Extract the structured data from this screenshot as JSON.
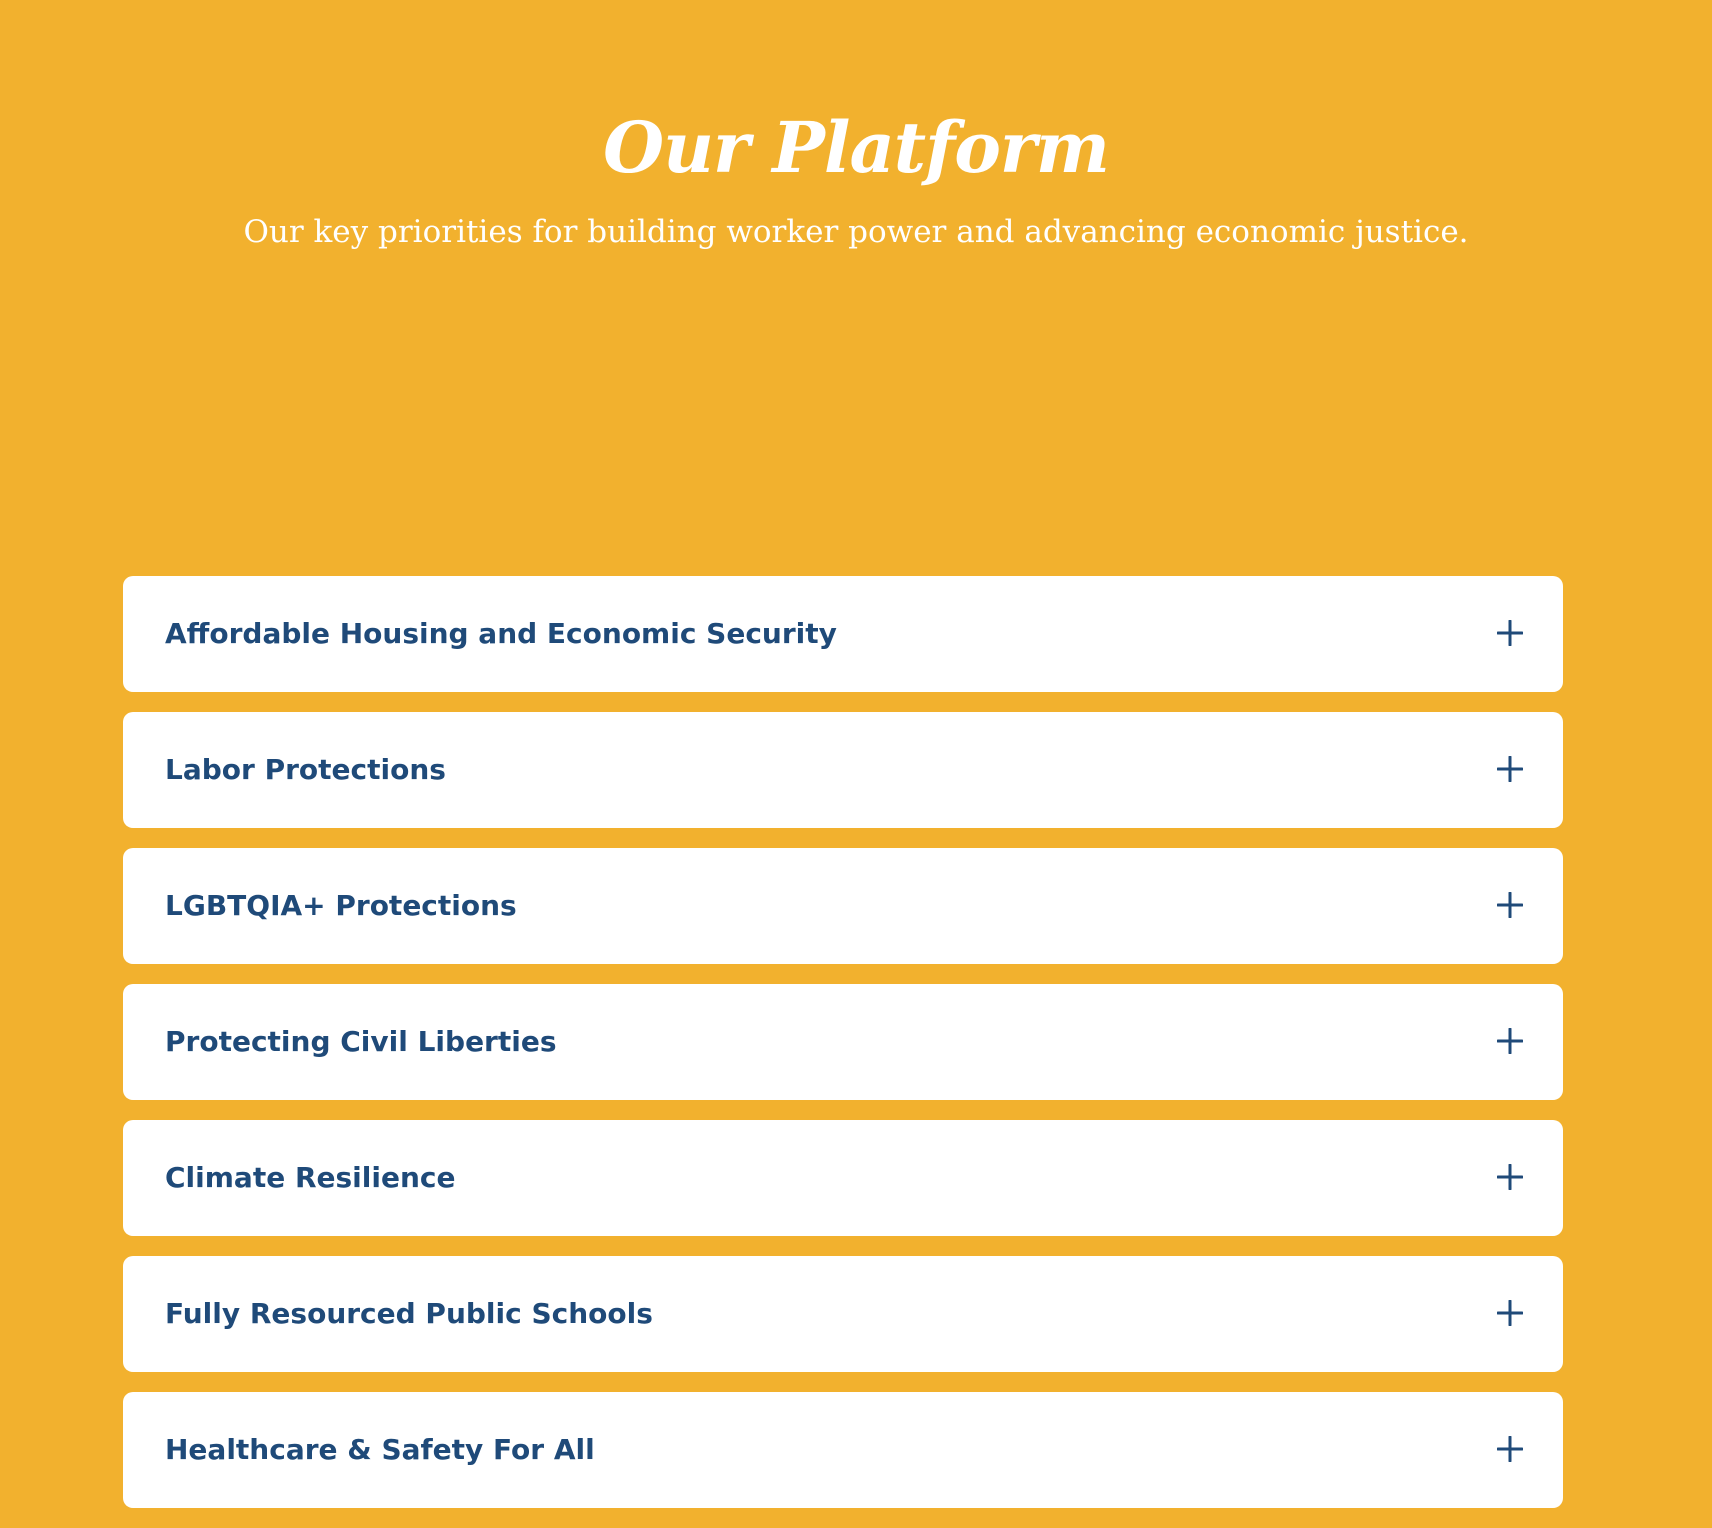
{
  "header": {
    "title": "Our Platform",
    "subtitle": "Our key priorities for building worker power and advancing economic justice."
  },
  "accordion": {
    "items": [
      {
        "label": "Affordable Housing and Economic Security",
        "icon": "plus-icon"
      },
      {
        "label": "Labor Protections",
        "icon": "plus-icon"
      },
      {
        "label": "LGBTQIA+ Protections",
        "icon": "plus-icon"
      },
      {
        "label": "Protecting Civil Liberties",
        "icon": "plus-icon"
      },
      {
        "label": "Climate Resilience",
        "icon": "plus-icon"
      },
      {
        "label": "Fully Resourced Public Schools",
        "icon": "plus-icon"
      },
      {
        "label": "Healthcare & Safety For All",
        "icon": "plus-icon"
      }
    ]
  },
  "colors": {
    "background": "#F2B12E",
    "card": "#FFFFFF",
    "text_accent": "#1F4A79"
  }
}
